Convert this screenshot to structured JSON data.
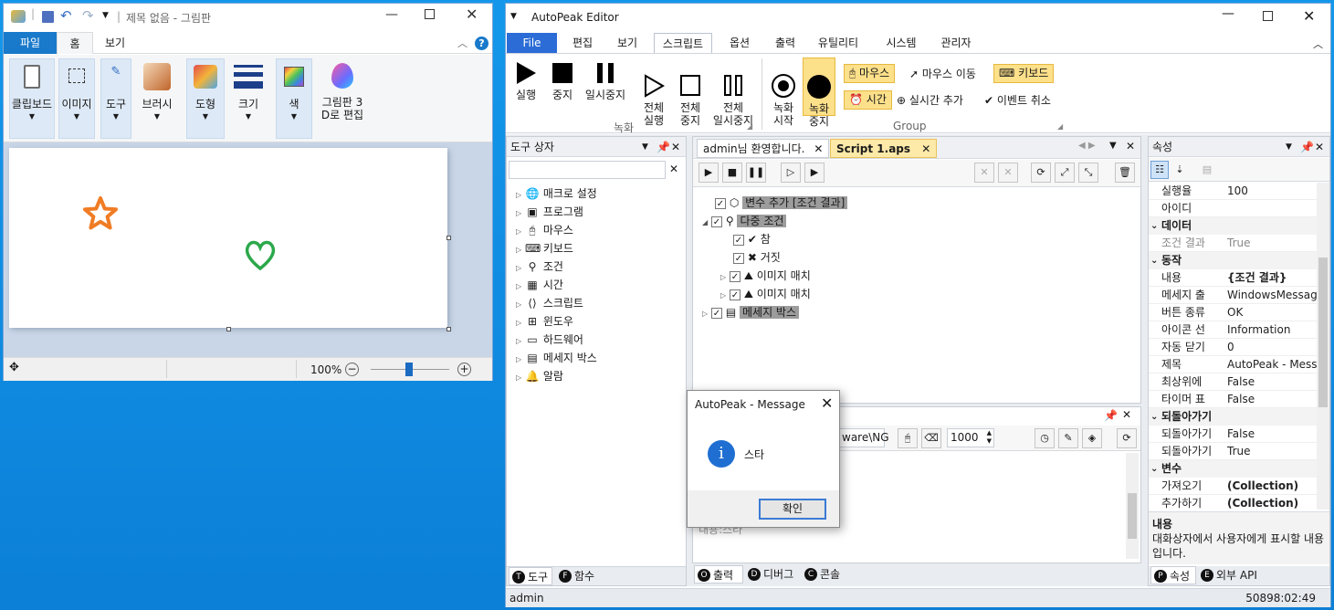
{
  "paint": {
    "title": "제목 없음 - 그림판",
    "tabs": [
      "파일",
      "홈",
      "보기"
    ],
    "groups": [
      {
        "label": "클립보드"
      },
      {
        "label": "이미지"
      },
      {
        "label": "도구"
      },
      {
        "label": "브러시"
      },
      {
        "label": "도형"
      },
      {
        "label": "크기"
      },
      {
        "label": "색"
      },
      {
        "label": "그림판 3\nD로 편집"
      }
    ],
    "zoom": "100%",
    "shapes": {
      "star_color": "#f07c24",
      "heart_color": "#2ba84a"
    }
  },
  "ap": {
    "title": "AutoPeak Editor",
    "menu": [
      "File",
      "편집",
      "보기",
      "스크립트",
      "옵션",
      "출력",
      "유틸리티",
      "시스템",
      "관리자"
    ],
    "ribbon": {
      "run": "실행",
      "stop": "중지",
      "pause": "일시중지",
      "run_all": "전체\n실행",
      "stop_all": "전체\n중지",
      "pause_all": "전체\n일시중지",
      "group1": "녹화",
      "rec_start": "녹화\n시작",
      "rec_stop": "녹화\n중지",
      "mouse": "마우스",
      "mouse_move": "마우스 이동",
      "keyboard": "키보드",
      "time": "시간",
      "add_time": "실시간 추가",
      "cancel_event": "이벤트 취소",
      "group2": "Group"
    },
    "toolbox": {
      "title": "도구 상자",
      "items": [
        "매크로 설정",
        "프로그램",
        "마우스",
        "키보드",
        "조건",
        "시간",
        "스크립트",
        "윈도우",
        "하드웨어",
        "메세지 박스",
        "알람"
      ],
      "tabs": [
        "도구",
        "함수"
      ],
      "tab_letters": [
        "T",
        "F"
      ]
    },
    "doc_tabs": [
      "admin님 환영합니다.",
      "Script 1.aps"
    ],
    "script": [
      {
        "label": "변수 추가 [조건 결과]",
        "hl": true
      },
      {
        "label": "다중 조건",
        "hl": true
      },
      {
        "label": "참",
        "hl": false
      },
      {
        "label": "거짓",
        "hl": false
      },
      {
        "label": "이미지 매치",
        "hl": false
      },
      {
        "label": "이미지 매치",
        "hl": false
      },
      {
        "label": "메세지 박스",
        "hl": true
      }
    ],
    "output": {
      "path": "ware\\NG",
      "value": "1000",
      "text": "내용:스타",
      "tabs": [
        "출력",
        "디버그",
        "콘솔"
      ],
      "tab_letters": [
        "O",
        "D",
        "C"
      ]
    },
    "props": {
      "title": "속성",
      "rows": [
        {
          "t": "r",
          "k": "실행율",
          "v": "100",
          "b": false,
          "g": false
        },
        {
          "t": "r",
          "k": "아이디",
          "v": "",
          "b": false,
          "g": false
        },
        {
          "t": "c",
          "k": "데이터"
        },
        {
          "t": "r",
          "k": "조건 결과",
          "v": "True",
          "b": false,
          "g": true
        },
        {
          "t": "c",
          "k": "동작"
        },
        {
          "t": "r",
          "k": "내용",
          "v": "{조건 결과}",
          "b": true,
          "g": false
        },
        {
          "t": "r",
          "k": "메세지 출",
          "v": "WindowsMessage",
          "b": false,
          "g": false
        },
        {
          "t": "r",
          "k": "버튼 종류",
          "v": "OK",
          "b": false,
          "g": false
        },
        {
          "t": "r",
          "k": "아이콘 선",
          "v": "Information",
          "b": false,
          "g": false
        },
        {
          "t": "r",
          "k": "자동 닫기",
          "v": "0",
          "b": false,
          "g": false
        },
        {
          "t": "r",
          "k": "제목",
          "v": "AutoPeak - Message",
          "b": false,
          "g": false
        },
        {
          "t": "r",
          "k": "최상위에",
          "v": "False",
          "b": false,
          "g": false
        },
        {
          "t": "r",
          "k": "타이머 표",
          "v": "False",
          "b": false,
          "g": false
        },
        {
          "t": "c",
          "k": "되돌아가기"
        },
        {
          "t": "r",
          "k": "되돌아가기",
          "v": "False",
          "b": false,
          "g": false
        },
        {
          "t": "r",
          "k": "되돌아가기",
          "v": "True",
          "b": false,
          "g": false
        },
        {
          "t": "c",
          "k": "변수"
        },
        {
          "t": "r",
          "k": "가져오기",
          "v": "(Collection)",
          "b": true,
          "g": false
        },
        {
          "t": "r",
          "k": "추가하기",
          "v": "(Collection)",
          "b": true,
          "g": false
        }
      ],
      "desc_title": "내용",
      "desc": "대화상자에서 사용자에게 표시할 내용입니다.",
      "tabs": [
        "속성",
        "외부 API"
      ],
      "tab_letters": [
        "P",
        "E"
      ]
    },
    "status_left": "admin",
    "status_right": "50898:02:49"
  },
  "dialog": {
    "title": "AutoPeak - Message",
    "message": "스타",
    "ok": "확인"
  }
}
